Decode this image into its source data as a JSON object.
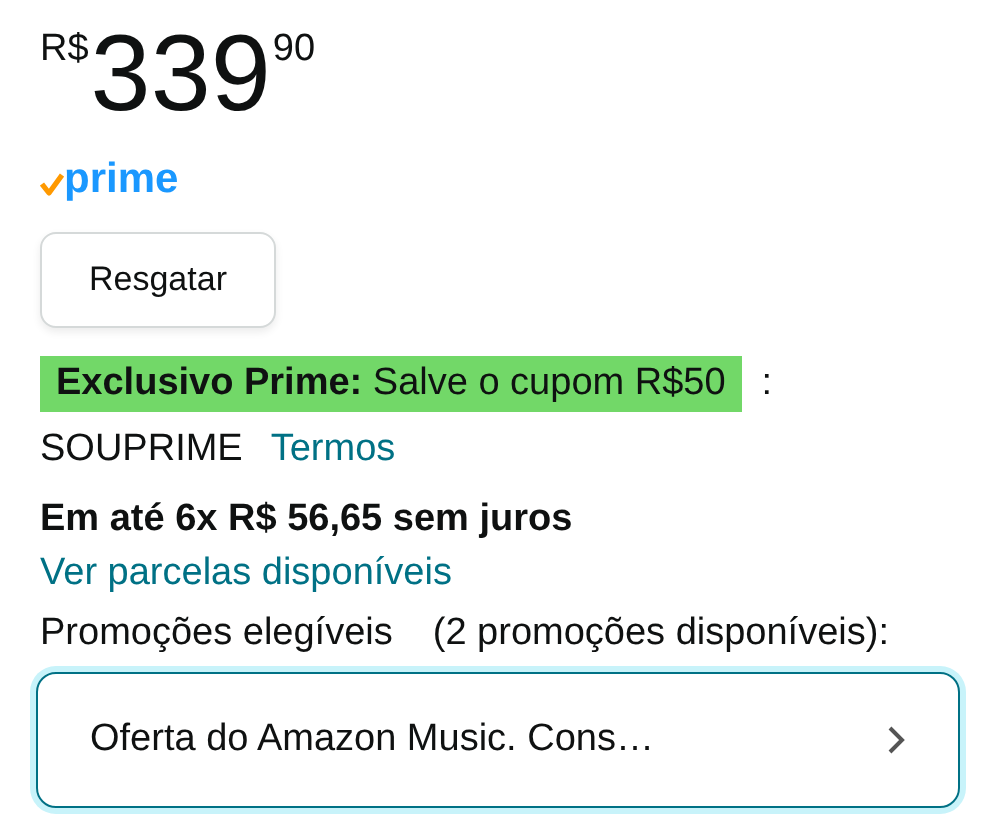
{
  "price": {
    "currency": "R$",
    "whole": "339",
    "cents": "90"
  },
  "prime_badge": {
    "label": "prime"
  },
  "redeem_button": {
    "label": "Resgatar"
  },
  "coupon": {
    "highlight": "**Exclusivo Prime:** Salve o cupom R$50",
    "suffix": ":",
    "code": "SOUPRIME",
    "terms_link": "Termos"
  },
  "installments": {
    "text": "Em até 6x R$ 56,65 sem juros",
    "link": "Ver parcelas disponíveis"
  },
  "promotions": {
    "label": "Promoções elegíveis",
    "count": "(2 promoções disponíveis):",
    "selector": {
      "text": "Oferta do Amazon Music. Cons…"
    }
  }
}
